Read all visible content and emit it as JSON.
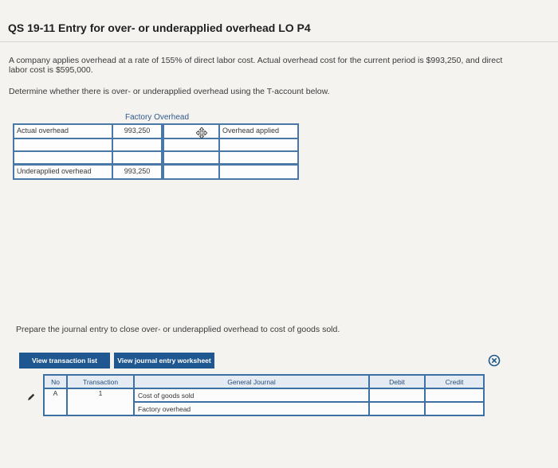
{
  "title": "QS 19-11 Entry for over- or underapplied overhead LO P4",
  "problem": {
    "line1": "A company applies overhead at a rate of 155% of direct labor cost. Actual overhead cost for the current period is $993,250, and direct",
    "line2": "labor cost is $595,000.",
    "instruction": "Determine whether there is over- or underapplied overhead using the T-account below."
  },
  "t_account": {
    "title": "Factory Overhead",
    "row1_left_label": "Actual overhead",
    "row1_left_value": "993,250",
    "row1_right_label": "Overhead applied",
    "row1_right_value": "",
    "row4_left_label": "Underapplied overhead",
    "row4_left_value": "993,250",
    "row4_right_label": "",
    "row4_right_value": ""
  },
  "journal_prompt": "Prepare the journal entry to close over- or underapplied overhead to cost of goods sold.",
  "buttons": {
    "view_transaction_list": "View transaction list",
    "view_journal_worksheet": "View journal entry worksheet"
  },
  "journal": {
    "headers": [
      "No",
      "Transaction",
      "General Journal",
      "Debit",
      "Credit"
    ],
    "entry": {
      "no": "A",
      "transaction": "1",
      "account1": "Cost of goods sold",
      "account2": "Factory overhead",
      "debit1": "",
      "credit1": "",
      "debit2": "",
      "credit2": ""
    }
  },
  "icons": {
    "move": "move-cursor-icon",
    "close": "close-circle-icon",
    "edit": "pencil-icon"
  },
  "colors": {
    "accent": "#1f5790",
    "border": "#4a78a6"
  }
}
